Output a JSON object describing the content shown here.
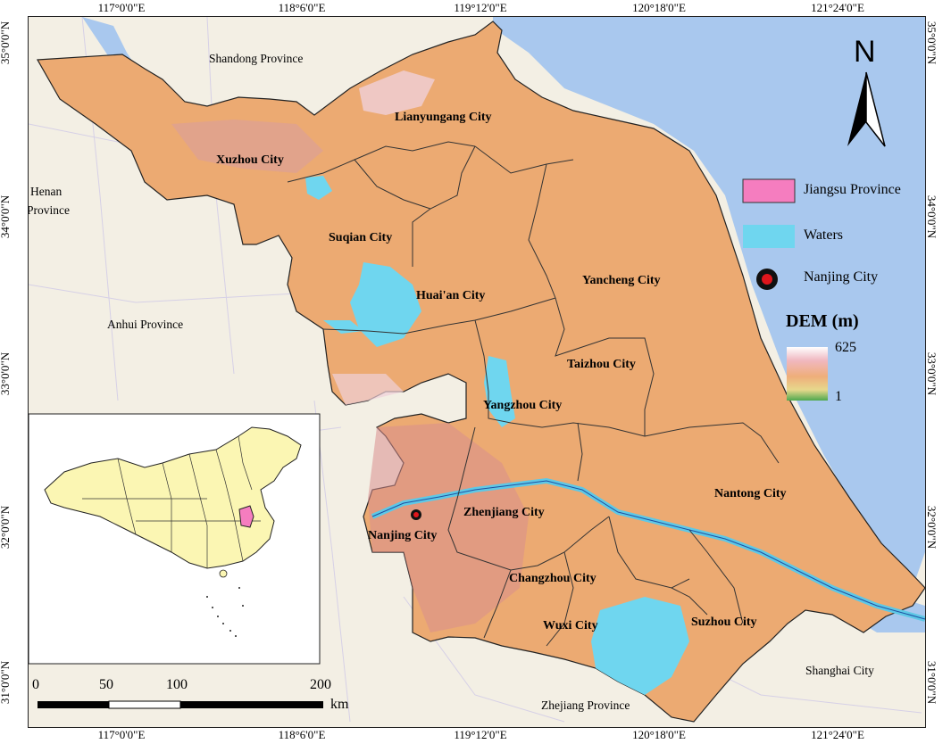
{
  "coords": {
    "top": [
      "117°0'0\"E",
      "118°6'0\"E",
      "119°12'0\"E",
      "120°18'0\"E",
      "121°24'0\"E"
    ],
    "bottom": [
      "117°0'0\"E",
      "118°6'0\"E",
      "119°12'0\"E",
      "120°18'0\"E",
      "121°24'0\"E"
    ],
    "left": [
      "35°0'0\"N",
      "34°0'0\"N",
      "33°0'0\"N",
      "32°0'0\"N",
      "31°0'0\"N"
    ],
    "right": [
      "35°0'0\"N",
      "34°0'0\"N",
      "33°0'0\"N",
      "32°0'0\"N",
      "31°0'0\"N"
    ]
  },
  "cities": {
    "xuzhou": "Xuzhou City",
    "lianyungang": "Lianyungang City",
    "suqian": "Suqian City",
    "huaian": "Huai'an City",
    "yancheng": "Yancheng City",
    "taizhou": "Taizhou City",
    "yangzhou": "Yangzhou City",
    "nantong": "Nantong City",
    "zhenjiang": "Zhenjiang City",
    "nanjing": "Nanjing City",
    "changzhou": "Changzhou City",
    "wuxi": "Wuxi City",
    "suzhou": "Suzhou City"
  },
  "neighbors": {
    "shandong": "Shandong Province",
    "henan_line1": "Henan",
    "henan_line2": "Province",
    "anhui": "Anhui Province",
    "zhejiang": "Zhejiang Province",
    "shanghai": "Shanghai City"
  },
  "north_arrow": "N",
  "legend": {
    "jiangsu": "Jiangsu Province",
    "waters": "Waters",
    "nanjing": "Nanjing City"
  },
  "dem": {
    "title": "DEM (m)",
    "max": "625",
    "min": "1"
  },
  "scale": {
    "ticks": [
      "0",
      "50",
      "100",
      "200"
    ],
    "unit": "km"
  },
  "colors": {
    "sea": "#a9c8ee",
    "land_dem": "#ecaa72",
    "waters": "#6fd6ef",
    "jiangsu_fill": "#f57dbf",
    "china_fill": "#fbf6b3",
    "nanjing_marker": "#e0161c"
  }
}
